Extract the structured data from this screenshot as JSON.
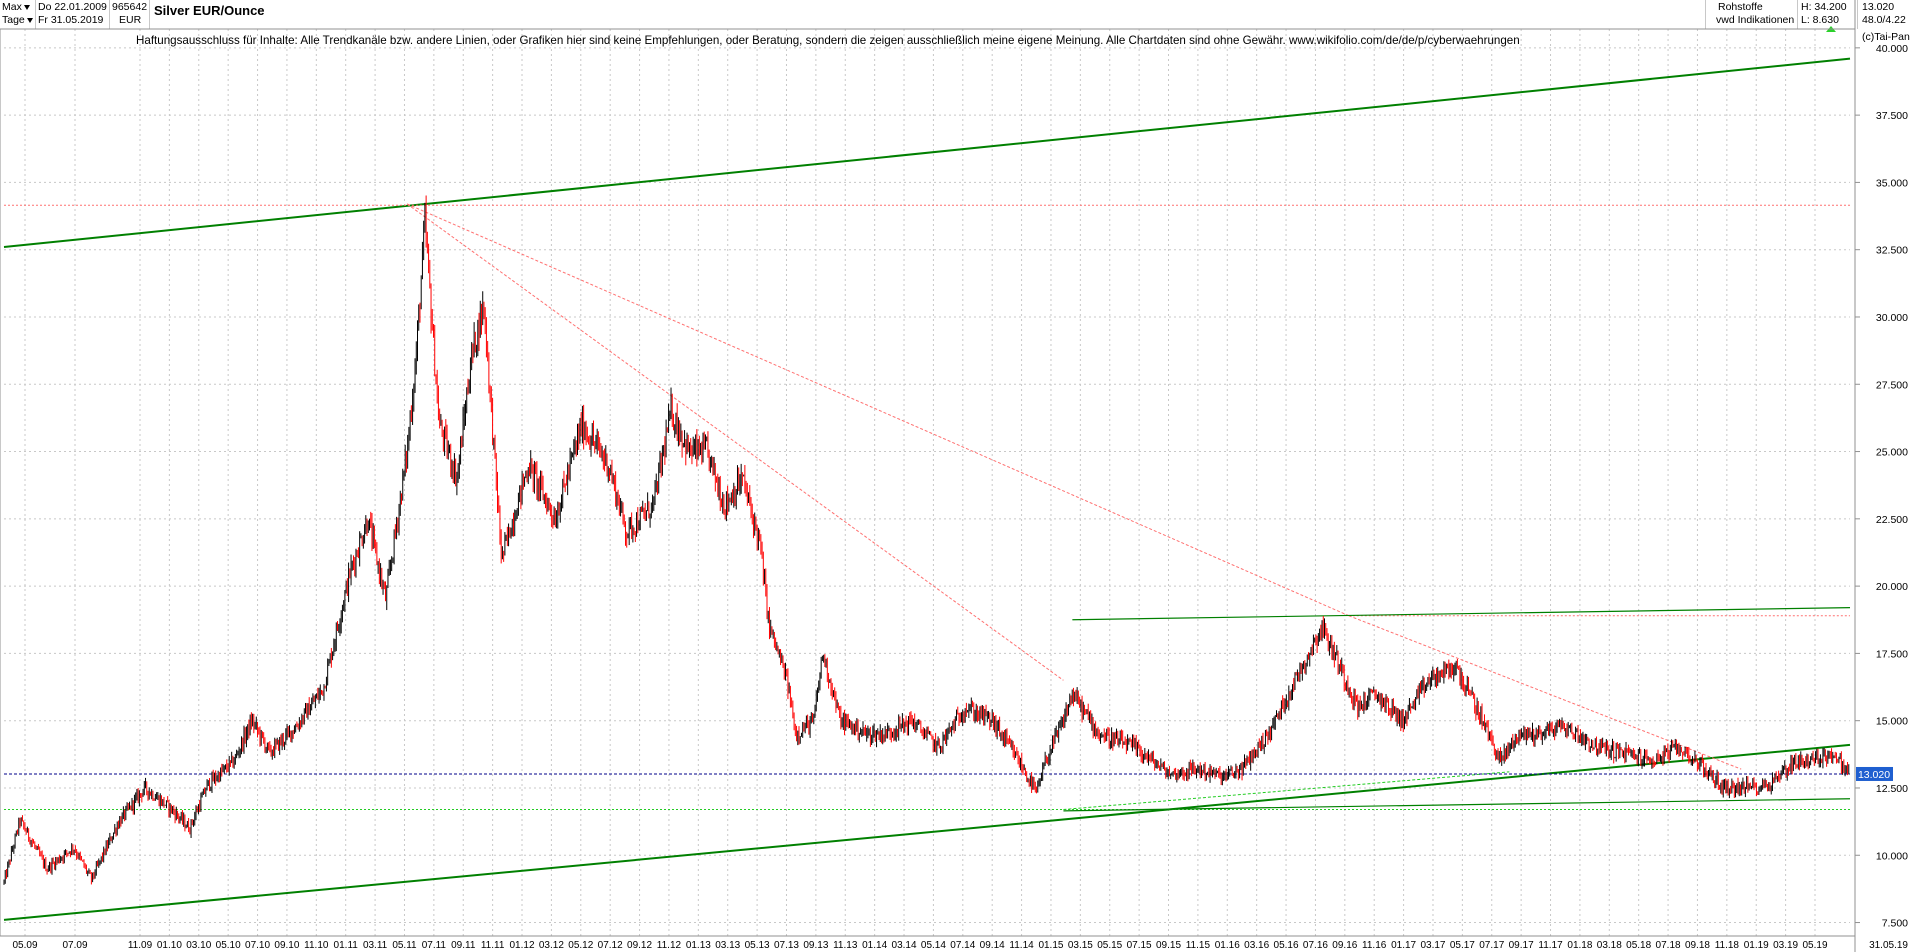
{
  "header": {
    "period_label": "Max",
    "interval_label": "Tage",
    "start_date": "Do 22.01.2009",
    "end_date": "Fr 31.05.2019",
    "symbol_id": "965642",
    "currency": "EUR",
    "title": "Silver EUR/Ounce",
    "category": "Rohstoffe",
    "source": "vwd Indikationen",
    "high_label": "H: 34.200",
    "low_label": "L: 8.630",
    "last_value": "13.020",
    "last_info": "48.0/4.22",
    "copyright": "(c)Tai-Pan"
  },
  "disclaimer": "Haftungsausschluss für Inhalte: Alle Trendkanäle bzw. andere Linien, oder Grafiken hier sind keine Empfehlungen, oder Beratung, sondern die zeigen ausschließlich meine eigene Meinung. Alle Chartdaten sind ohne Gewähr.  www.wikifolio.com/de/de/p/cyberwaehrungen",
  "colors": {
    "candle_up": "#000000",
    "candle_down": "#ff0000",
    "trend_green": "#008000",
    "light_green": "#22cc22",
    "resistance_red": "#ff7070",
    "price_line": "#00008b",
    "price_tag": "#1f5fd0"
  },
  "chart_data": {
    "type": "line",
    "title": "Silver EUR/Ounce",
    "ylim": [
      7.0,
      40.7
    ],
    "y_ticks": [
      "7.500",
      "10.000",
      "12.500",
      "15.000",
      "17.500",
      "20.000",
      "22.500",
      "25.000",
      "27.500",
      "30.000",
      "32.500",
      "35.000",
      "37.500",
      "40.000"
    ],
    "y_tick_values": [
      7.5,
      10,
      12.5,
      15,
      17.5,
      20,
      22.5,
      25,
      27.5,
      30,
      32.5,
      35,
      37.5,
      40
    ],
    "x_ticks": [
      "05.09",
      "07.09",
      "11.09",
      "01.10",
      "03.10",
      "05.10",
      "07.10",
      "09.10",
      "11.10",
      "01.11",
      "03.11",
      "05.11",
      "07.11",
      "09.11",
      "11.11",
      "01.12",
      "03.12",
      "05.12",
      "07.12",
      "09.12",
      "11.12",
      "01.13",
      "03.13",
      "05.13",
      "07.13",
      "09.13",
      "11.13",
      "01.14",
      "03.14",
      "05.14",
      "07.14",
      "09.14",
      "11.14",
      "01.15",
      "03.15",
      "05.15",
      "07.15",
      "09.15",
      "11.15",
      "01.16",
      "03.16",
      "05.16",
      "07.16",
      "09.16",
      "11.16",
      "01.17",
      "03.17",
      "05.17",
      "07.17",
      "09.17",
      "11.17",
      "01.18",
      "03.18",
      "05.18",
      "07.18",
      "09.18",
      "11.18",
      "01.19",
      "03.19",
      "05.19"
    ],
    "x_tick_end_label": "31.05.19",
    "grid": true,
    "current_price": 13.02,
    "series": [
      {
        "values_x": [
          2009.06,
          2009.15,
          2009.3,
          2009.45,
          2009.55,
          2009.7,
          2009.85,
          2010.0,
          2010.1,
          2010.2,
          2010.35,
          2010.45,
          2010.55,
          2010.7,
          2010.85,
          2011.0,
          2011.1,
          2011.2,
          2011.32,
          2011.37,
          2011.42,
          2011.5,
          2011.6,
          2011.68,
          2011.75,
          2011.85,
          2012.0,
          2012.15,
          2012.3,
          2012.45,
          2012.55,
          2012.7,
          2012.8,
          2012.9,
          2013.0,
          2013.1,
          2013.2,
          2013.3,
          2013.35,
          2013.45,
          2013.5,
          2013.6,
          2013.65,
          2013.75,
          2013.9,
          2014.0,
          2014.15,
          2014.3,
          2014.45,
          2014.6,
          2014.75,
          2014.85,
          2014.9,
          2015.0,
          2015.05,
          2015.2,
          2015.4,
          2015.6,
          2015.75,
          2015.9,
          2016.0,
          2016.15,
          2016.3,
          2016.45,
          2016.55,
          2016.65,
          2016.75,
          2016.9,
          2017.05,
          2017.2,
          2017.35,
          2017.45,
          2017.55,
          2017.65,
          2017.8,
          2018.0,
          2018.15,
          2018.3,
          2018.45,
          2018.55,
          2018.7,
          2018.8,
          2018.95,
          2019.1,
          2019.2,
          2019.3,
          2019.42
        ],
        "values_y": [
          9.0,
          11.3,
          9.5,
          10.3,
          9.1,
          11.2,
          12.5,
          11.7,
          11.0,
          12.6,
          13.5,
          15.0,
          13.8,
          14.8,
          16.2,
          20.5,
          22.5,
          19.5,
          25.0,
          28.5,
          33.5,
          26.0,
          24.0,
          28.5,
          30.5,
          21.0,
          24.5,
          22.5,
          26.0,
          24.5,
          22.0,
          23.0,
          26.5,
          25.0,
          25.0,
          23.0,
          24.0,
          21.5,
          18.5,
          16.5,
          14.5,
          15.0,
          17.5,
          15.0,
          14.5,
          14.5,
          15.0,
          14.0,
          15.5,
          15.0,
          13.5,
          12.3,
          13.5,
          15.0,
          16.0,
          14.5,
          14.0,
          13.0,
          13.2,
          12.9,
          13.2,
          14.5,
          16.5,
          18.5,
          17.0,
          15.5,
          16.0,
          15.0,
          16.5,
          17.0,
          15.0,
          13.5,
          14.5,
          14.5,
          14.8,
          14.0,
          13.8,
          13.5,
          14.0,
          13.5,
          12.5,
          12.5,
          12.6,
          13.5,
          13.5,
          13.8,
          13.0
        ]
      }
    ],
    "annotations": [
      {
        "kind": "upper_channel_line",
        "x": [
          2009.06,
          2019.41
        ],
        "y": [
          32.6,
          39.6
        ]
      },
      {
        "kind": "lower_channel_line",
        "x": [
          2009.06,
          2019.41
        ],
        "y": [
          7.6,
          14.1
        ]
      },
      {
        "kind": "horizontal_dotted",
        "y": 34.15
      },
      {
        "kind": "horizontal_dotted",
        "y": 11.7
      },
      {
        "kind": "horizontal_dotted_red",
        "y": 18.9
      },
      {
        "kind": "resistance_dotted",
        "x": [
          2011.32,
          2016.6
        ],
        "y": [
          34.2,
          18.9
        ]
      },
      {
        "kind": "resistance_dotted",
        "x": [
          2011.32,
          2015.0
        ],
        "y": [
          34.2,
          16.5
        ]
      },
      {
        "kind": "resistance_dotted",
        "x": [
          2016.6,
          2018.8
        ],
        "y": [
          18.9,
          13.2
        ]
      },
      {
        "kind": "upper_green",
        "x": [
          2015.05,
          2019.41
        ],
        "y": [
          18.75,
          19.2
        ]
      },
      {
        "kind": "lower_green",
        "x": [
          2015.0,
          2019.41
        ],
        "y": [
          11.65,
          12.1
        ]
      }
    ]
  }
}
